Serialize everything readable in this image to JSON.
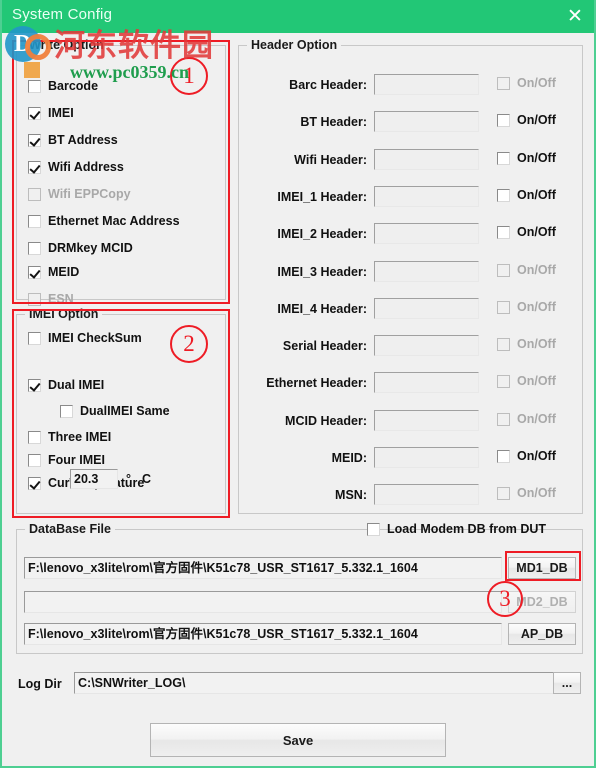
{
  "window": {
    "title": "System Config",
    "close_icon": "close-icon",
    "titlebar_color": "#22c776",
    "border_color": "#4ecf92",
    "annotation_color": "#ee1c25"
  },
  "watermark": {
    "chinese": "河东软件园",
    "url": "www.pc0359.cn",
    "logo_letter": "D"
  },
  "write_option": {
    "title": "Write Option",
    "items": [
      {
        "label": "Barcode",
        "checked": false,
        "disabled": false
      },
      {
        "label": "IMEI",
        "checked": true,
        "disabled": false
      },
      {
        "label": "BT Address",
        "checked": true,
        "disabled": false
      },
      {
        "label": "Wifi Address",
        "checked": true,
        "disabled": false
      },
      {
        "label": "Wifi EPPCopy",
        "checked": false,
        "disabled": true
      },
      {
        "label": "Ethernet Mac Address",
        "checked": false,
        "disabled": false
      },
      {
        "label": "DRMkey MCID",
        "checked": false,
        "disabled": false
      },
      {
        "label": "MEID",
        "checked": true,
        "disabled": false
      },
      {
        "label": "ESN",
        "checked": false,
        "disabled": true
      }
    ]
  },
  "imei_option": {
    "title": "IMEI Option",
    "items": [
      {
        "label": "IMEI CheckSum",
        "checked": false,
        "disabled": false
      },
      {
        "label": "Dual IMEI",
        "checked": true,
        "disabled": false
      },
      {
        "label": "DualIMEI Same",
        "checked": false,
        "disabled": false
      },
      {
        "label": "Three IMEI",
        "checked": false,
        "disabled": false
      },
      {
        "label": "Four IMEI",
        "checked": false,
        "disabled": false
      },
      {
        "label": "CurTemperature",
        "checked": true,
        "disabled": false
      }
    ],
    "temperature_value": "20.3",
    "temperature_unit_degree": "°",
    "temperature_unit_c": "C"
  },
  "header_option": {
    "title": "Header Option",
    "toggle_label": "On/Off",
    "rows": [
      {
        "label": "Barc Header:",
        "value": "",
        "on": false,
        "disabled": true
      },
      {
        "label": "BT Header:",
        "value": "",
        "on": false,
        "disabled": false
      },
      {
        "label": "Wifi Header:",
        "value": "",
        "on": false,
        "disabled": false
      },
      {
        "label": "IMEI_1 Header:",
        "value": "",
        "on": false,
        "disabled": false
      },
      {
        "label": "IMEI_2 Header:",
        "value": "",
        "on": false,
        "disabled": false
      },
      {
        "label": "IMEI_3 Header:",
        "value": "",
        "on": false,
        "disabled": true
      },
      {
        "label": "IMEI_4 Header:",
        "value": "",
        "on": false,
        "disabled": true
      },
      {
        "label": "Serial Header:",
        "value": "",
        "on": false,
        "disabled": true
      },
      {
        "label": "Ethernet Header:",
        "value": "",
        "on": false,
        "disabled": true
      },
      {
        "label": "MCID Header:",
        "value": "",
        "on": false,
        "disabled": true
      },
      {
        "label": "MEID:",
        "value": "",
        "on": false,
        "disabled": false
      },
      {
        "label": "MSN:",
        "value": "",
        "on": false,
        "disabled": true
      }
    ]
  },
  "database_file": {
    "title": "DataBase File",
    "load_modem_label": "Load Modem DB from DUT",
    "load_modem_checked": false,
    "rows": [
      {
        "path": "F:\\lenovo_x3lite\\rom\\官方固件\\K51c78_USR_ST1617_5.332.1_1604",
        "button": "MD1_DB",
        "disabled": false
      },
      {
        "path": "",
        "button": "MD2_DB",
        "disabled": true
      },
      {
        "path": "F:\\lenovo_x3lite\\rom\\官方固件\\K51c78_USR_ST1617_5.332.1_1604",
        "button": "AP_DB",
        "disabled": false
      }
    ]
  },
  "log_dir": {
    "label": "Log Dir",
    "value": "C:\\SNWriter_LOG\\",
    "browse_button": "..."
  },
  "save_button": {
    "label": "Save"
  },
  "annotations": [
    {
      "number": "①",
      "text": "1"
    },
    {
      "number": "②",
      "text": "2"
    },
    {
      "number": "③",
      "text": "3"
    }
  ]
}
